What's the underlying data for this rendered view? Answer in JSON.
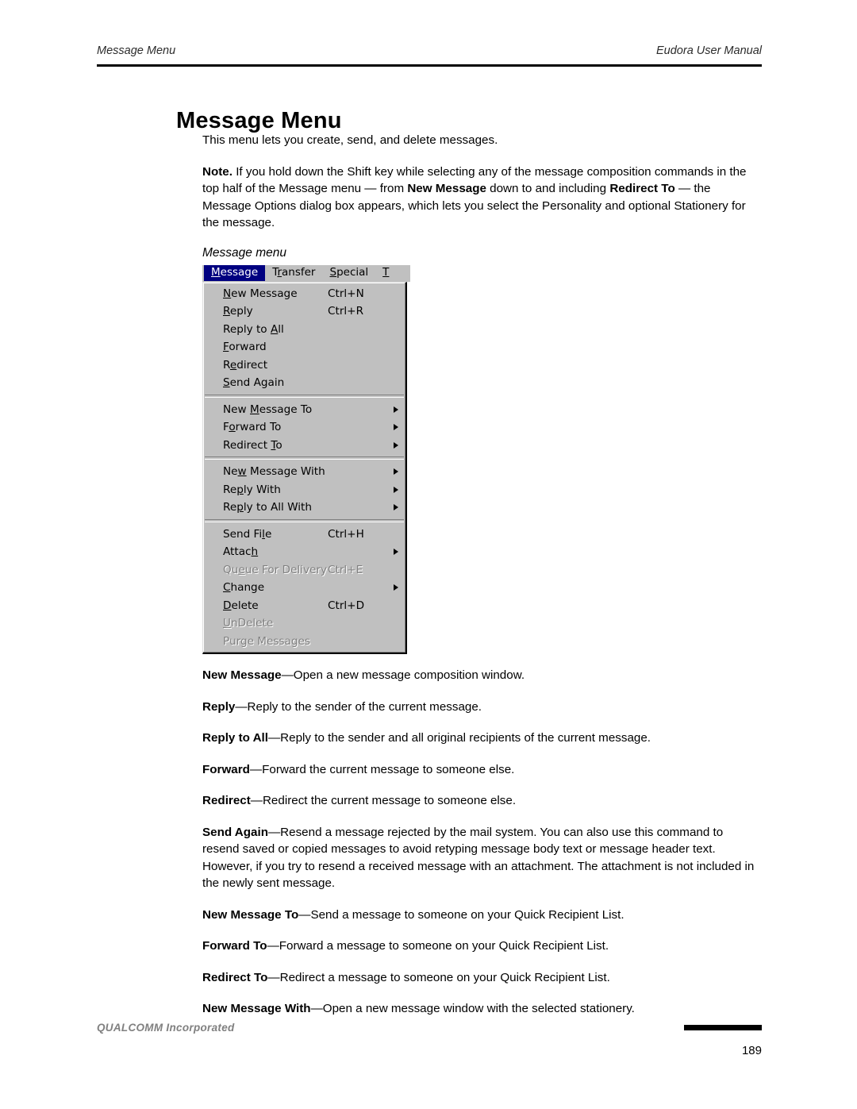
{
  "header": {
    "left": "Message Menu",
    "right": "Eudora User Manual"
  },
  "title": "Message Menu",
  "paragraphs": {
    "intro": "This menu lets you create, send, and delete messages.",
    "note_bold": "Note.",
    "note_1": " If you hold down the Shift key while selecting any of the message composition commands in the top half of the Message menu — from ",
    "note_b2": "New Message",
    "note_2": " down to and including ",
    "note_b3": "Redirect To",
    "note_3": " — the Message Options dialog box appears, which lets you select the Personality and optional Stationery for the message."
  },
  "figure_caption": "Message menu",
  "menu": {
    "menubar": [
      {
        "label": "Message",
        "accel_index": 0,
        "active": true
      },
      {
        "label": "Transfer",
        "accel_index": 1,
        "active": false
      },
      {
        "label": "Special",
        "accel_index": 0,
        "active": false
      },
      {
        "label": "T",
        "accel_index": 0,
        "active": false
      }
    ],
    "groups": [
      {
        "items": [
          {
            "label": "New Message",
            "accel_index": 0,
            "shortcut": "Ctrl+N",
            "submenu": false,
            "disabled": false
          },
          {
            "label": "Reply",
            "accel_index": 0,
            "shortcut": "Ctrl+R",
            "submenu": false,
            "disabled": false
          },
          {
            "label": "Reply to All",
            "accel_index": 9,
            "shortcut": "",
            "submenu": false,
            "disabled": false
          },
          {
            "label": "Forward",
            "accel_index": 0,
            "shortcut": "",
            "submenu": false,
            "disabled": false
          },
          {
            "label": "Redirect",
            "accel_index": 1,
            "shortcut": "",
            "submenu": false,
            "disabled": false
          },
          {
            "label": "Send Again",
            "accel_index": 0,
            "shortcut": "",
            "submenu": false,
            "disabled": false
          }
        ]
      },
      {
        "items": [
          {
            "label": "New Message To",
            "accel_index": 4,
            "shortcut": "",
            "submenu": true,
            "disabled": false
          },
          {
            "label": "Forward To",
            "accel_index": 1,
            "shortcut": "",
            "submenu": true,
            "disabled": false
          },
          {
            "label": "Redirect To",
            "accel_index": 9,
            "shortcut": "",
            "submenu": true,
            "disabled": false
          }
        ]
      },
      {
        "items": [
          {
            "label": "New Message With",
            "accel_index": 2,
            "shortcut": "",
            "submenu": true,
            "disabled": false
          },
          {
            "label": "Reply With",
            "accel_index": 2,
            "shortcut": "",
            "submenu": true,
            "disabled": false
          },
          {
            "label": "Reply to All With",
            "accel_index": 2,
            "shortcut": "",
            "submenu": true,
            "disabled": false
          }
        ]
      },
      {
        "items": [
          {
            "label": "Send File",
            "accel_index": 7,
            "shortcut": "Ctrl+H",
            "submenu": false,
            "disabled": false
          },
          {
            "label": "Attach",
            "accel_index": 5,
            "shortcut": "",
            "submenu": true,
            "disabled": false
          },
          {
            "label": "Queue For Delivery",
            "accel_index": 2,
            "shortcut": "Ctrl+E",
            "submenu": false,
            "disabled": true
          },
          {
            "label": "Change",
            "accel_index": 0,
            "shortcut": "",
            "submenu": true,
            "disabled": false
          },
          {
            "label": "Delete",
            "accel_index": 0,
            "shortcut": "Ctrl+D",
            "submenu": false,
            "disabled": false
          },
          {
            "label": "UnDelete",
            "accel_index": 0,
            "shortcut": "",
            "submenu": false,
            "disabled": true
          },
          {
            "label": "Purge Messages",
            "accel_index": 3,
            "shortcut": "",
            "submenu": false,
            "disabled": true
          }
        ]
      }
    ],
    "colors": {
      "face": "#c0c0c0",
      "highlight": "#000080",
      "highlight_text": "#ffffff",
      "disabled_text": "#808080"
    }
  },
  "definitions": [
    {
      "term": "New Message",
      "text": "—Open a new message composition window."
    },
    {
      "term": "Reply",
      "text": "—Reply to the sender of the current message."
    },
    {
      "term": "Reply to All",
      "text": "—Reply to the sender and all original recipients of the current message."
    },
    {
      "term": "Forward",
      "text": "—Forward the current message to someone else."
    },
    {
      "term": "Redirect",
      "text": "—Redirect the current message to someone else."
    },
    {
      "term": "Send Again",
      "text": "—Resend a message rejected by the mail system. You can also use this command to resend saved or copied messages to avoid retyping message body text or message header text. However, if you try to resend a received message with an attachment. The attachment is not included in the newly sent message."
    },
    {
      "term": "New Message To",
      "text": "—Send a message to someone on your Quick Recipient List."
    },
    {
      "term": "Forward To",
      "text": "—Forward a message to someone on your Quick Recipient List."
    },
    {
      "term": "Redirect To",
      "text": "—Redirect a message to someone on your Quick Recipient List."
    },
    {
      "term": "New Message With",
      "text": "—Open a new message window with the selected stationery."
    }
  ],
  "footer": {
    "brand": "QUALCOMM Incorporated",
    "page_number": "189"
  }
}
